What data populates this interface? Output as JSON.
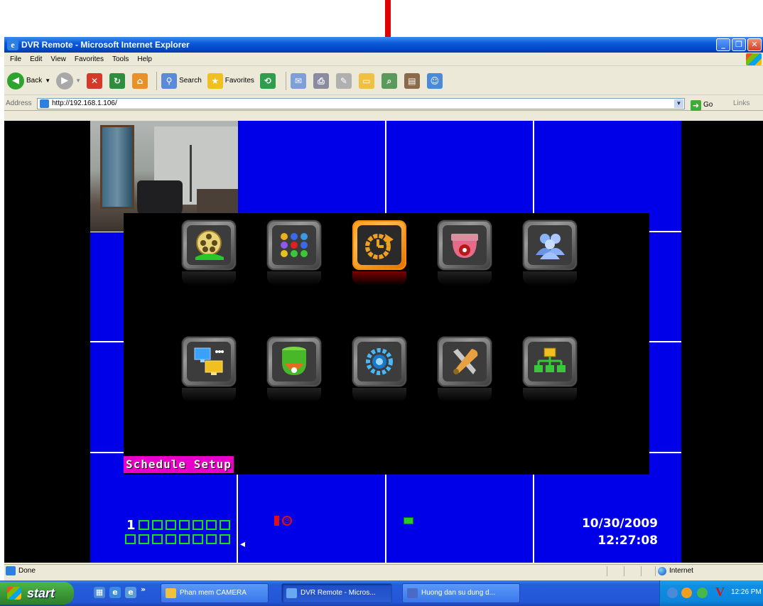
{
  "browser": {
    "title": "DVR Remote - Microsoft Internet Explorer",
    "menu": [
      "File",
      "Edit",
      "View",
      "Favorites",
      "Tools",
      "Help"
    ],
    "toolbar": {
      "back_label": "Back",
      "search_label": "Search",
      "favorites_label": "Favorites"
    },
    "address_label": "Address",
    "url": "http://192.168.1.106/",
    "go_label": "Go",
    "links_label": "Links",
    "status_text": "Done",
    "zone_text": "Internet"
  },
  "dvr": {
    "menu_icons_row1": [
      "playback-icon",
      "color-palette-icon",
      "schedule-icon",
      "camera-dome-icon",
      "users-icon"
    ],
    "menu_icons_row2": [
      "monitor-network-icon",
      "ptz-camera-icon",
      "settings-gear-icon",
      "tools-icon",
      "network-tree-icon"
    ],
    "selected_index": 2,
    "selected_label": "Schedule Setup",
    "channel_prefix": "1",
    "date": "10/30/2009",
    "time": "12:27:08"
  },
  "taskbar": {
    "start_label": "start",
    "tasks": [
      {
        "label": "Phan mem CAMERA",
        "icon": "folder-icon"
      },
      {
        "label": "DVR Remote - Micros...",
        "icon": "ie-icon"
      },
      {
        "label": "Huong dan su dung d...",
        "icon": "word-icon"
      }
    ],
    "clock": "12:26 PM"
  },
  "colors": {
    "dvr_grid_blue": "#0000e8",
    "selection_orange": "#ff8a00",
    "label_magenta": "#e800c8",
    "pointer_red": "#e00000",
    "channel_green": "#18e018"
  }
}
